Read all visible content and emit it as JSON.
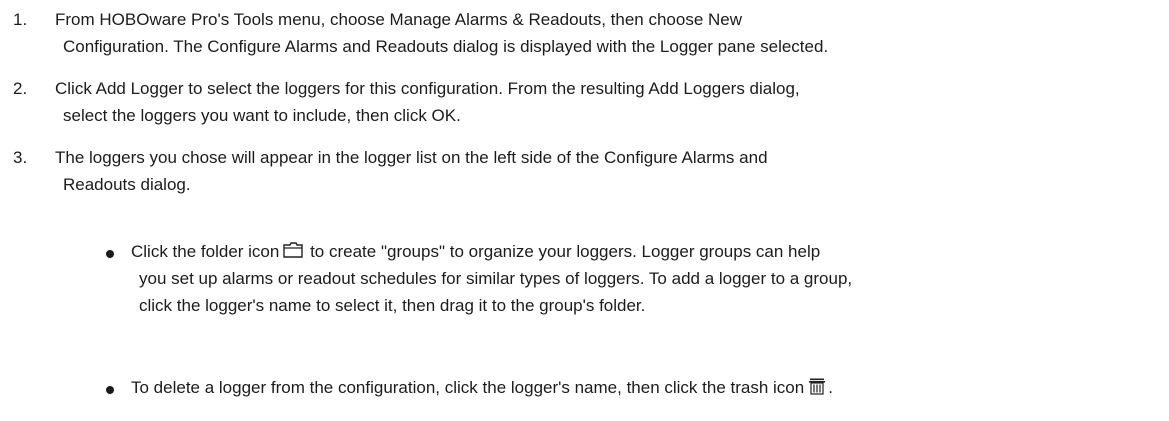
{
  "steps": [
    {
      "number": "1.",
      "line1": "From HOBOware Pro's Tools menu, choose Manage Alarms & Readouts, then choose New",
      "line2": "Configuration. The Configure Alarms and Readouts dialog is displayed with the Logger pane selected."
    },
    {
      "number": "2.",
      "line1": "Click Add Logger to select the loggers for this configuration. From the resulting Add Loggers dialog,",
      "line2": "select the loggers you want to include, then click OK."
    },
    {
      "number": "3.",
      "line1": "The loggers you chose will appear in the logger list on the left side of the Configure Alarms and",
      "line2": "Readouts dialog."
    }
  ],
  "bullets": [
    {
      "line1_before": "Click the folder icon",
      "icon": "folder-icon",
      "line1_after": "to create \"groups\" to organize your loggers. Logger groups can help",
      "line2": "you set up alarms or readout schedules for similar types of loggers. To add a logger to a group,",
      "line3": "click the logger's name to select it, then drag it to the group's folder."
    },
    {
      "line1_before": "To delete a logger from the configuration, click the logger's name, then click the trash icon",
      "icon": "trash-icon",
      "line1_after": "."
    }
  ]
}
